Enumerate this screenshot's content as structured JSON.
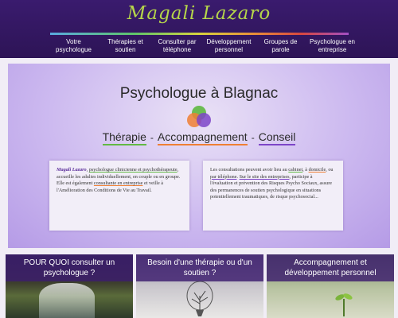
{
  "site": {
    "brand": "Magali Lazaro"
  },
  "nav": [
    {
      "label": "Votre psychologue"
    },
    {
      "label": "Thérapies et soutien"
    },
    {
      "label": "Consulter par téléphone"
    },
    {
      "label": "Développement personnel"
    },
    {
      "label": "Groupes de parole"
    },
    {
      "label": "Psychologue en entreprise"
    }
  ],
  "hero": {
    "title": "Psychologue à Blagnac",
    "tag1": "Thérapie",
    "tag2": "Accompagnement",
    "tag3": "Conseil",
    "sep": "-"
  },
  "card_left": {
    "name": "Magali Lazaro",
    "p1": ", ",
    "l1": "psychologue clinicienne et psychothérapeute",
    "p2": ", accueille les adultes individuellement, en couple ou en groupe. Elle est également ",
    "l2": "consultante en entreprise",
    "p3": " et veille à l'Amélioration des Conditions de Vie au Travail."
  },
  "card_right": {
    "p1": "Les consultations peuvent avoir lieu au ",
    "l1": "cabinet",
    "p2": ", à ",
    "l2": "domicile",
    "p3": ", ou ",
    "l3": "par téléphone",
    "p4": ". ",
    "l4": "Sur le site des entreprises",
    "p5": ", participe à l'évaluation et prévention des Risques Psycho Sociaux, assure des permanences de soutien psychologique en situations potentiellement traumatiques, de risque psychosocial..."
  },
  "tiles": [
    {
      "title": "POUR QUOI consulter un psychologue ?"
    },
    {
      "title": "Besoin d'une thérapie ou d'un soutien ?"
    },
    {
      "title": "Accompagnement et développement personnel"
    }
  ]
}
